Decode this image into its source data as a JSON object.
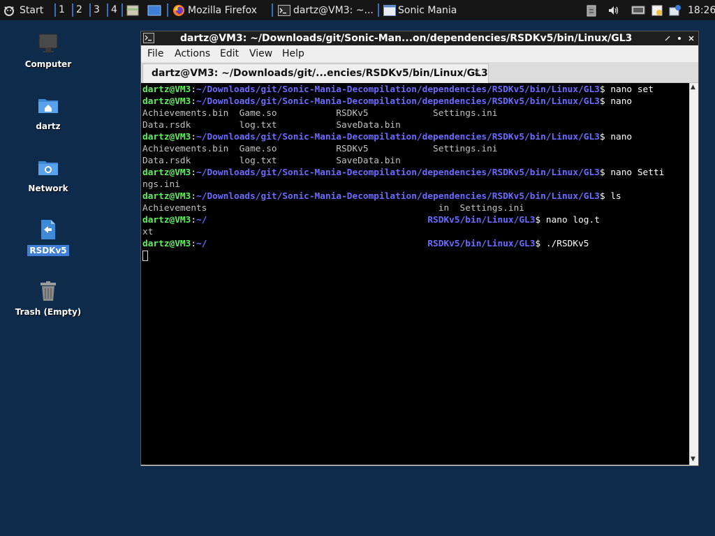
{
  "taskbar": {
    "start_label": "Start",
    "workspaces": [
      "1",
      "2",
      "3",
      "4"
    ],
    "tasks": [
      {
        "label": "Mozilla Firefox"
      },
      {
        "label": "dartz@VM3: ~..."
      },
      {
        "label": "Sonic Mania"
      }
    ],
    "clock": "18:26"
  },
  "desktop": {
    "icons": [
      {
        "label": "Computer"
      },
      {
        "label": "dartz"
      },
      {
        "label": "Network"
      },
      {
        "label": "RSDKv5"
      },
      {
        "label": "Trash (Empty)"
      }
    ]
  },
  "terminal": {
    "window_title": "dartz@VM3: ~/Downloads/git/Sonic-Man...on/dependencies/RSDKv5/bin/Linux/GL3",
    "menu": [
      "File",
      "Actions",
      "Edit",
      "View",
      "Help"
    ],
    "tab_title": "dartz@VM3: ~/Downloads/git/...encies/RSDKv5/bin/Linux/GL3",
    "tab_close": "×",
    "lines": [
      {
        "user": "dartz@VM3",
        "sep": ":",
        "path": "~/Downloads/git/Sonic-Mania-Decompilation/dependencies/RSDKv5/bin/Linux/GL3",
        "cmd": "$ nano set"
      },
      {
        "user": "dartz@VM3",
        "sep": ":",
        "path": "~/Downloads/git/Sonic-Mania-Decompilation/dependencies/RSDKv5/bin/Linux/GL3",
        "cmd": "$ nano"
      },
      {
        "text": "Achievements.bin  Game.so           RSDKv5            Settings.ini"
      },
      {
        "text": "Data.rsdk         log.txt           SaveData.bin"
      },
      {
        "user": "dartz@VM3",
        "sep": ":",
        "path": "~/Downloads/git/Sonic-Mania-Decompilation/dependencies/RSDKv5/bin/Linux/GL3",
        "cmd": "$ nano"
      },
      {
        "text": "Achievements.bin  Game.so           RSDKv5            Settings.ini"
      },
      {
        "text": "Data.rsdk         log.txt           SaveData.bin"
      },
      {
        "user": "dartz@VM3",
        "sep": ":",
        "path": "~/Downloads/git/Sonic-Mania-Decompilation/dependencies/RSDKv5/bin/Linux/GL3",
        "cmd": "$ nano Setti"
      },
      {
        "text": "ngs.ini"
      },
      {
        "user": "dartz@VM3",
        "sep": ":",
        "path": "~/Downloads/git/Sonic-Mania-Decompilation/dependencies/RSDKv5/bin/Linux/GL3",
        "cmd": "$ ls"
      },
      {
        "text": "Achievements                                           in  Settings.ini"
      },
      {
        "user": "dartz@VM3",
        "sep": ":",
        "path": "~/                                         RSDKv5/bin/Linux/GL3",
        "cmd": "$ nano log.t"
      },
      {
        "text": "xt"
      },
      {
        "user": "dartz@VM3",
        "sep": ":",
        "path": "~/                                         RSDKv5/bin/Linux/GL3",
        "cmd": "$ ./RSDKv5"
      }
    ]
  }
}
